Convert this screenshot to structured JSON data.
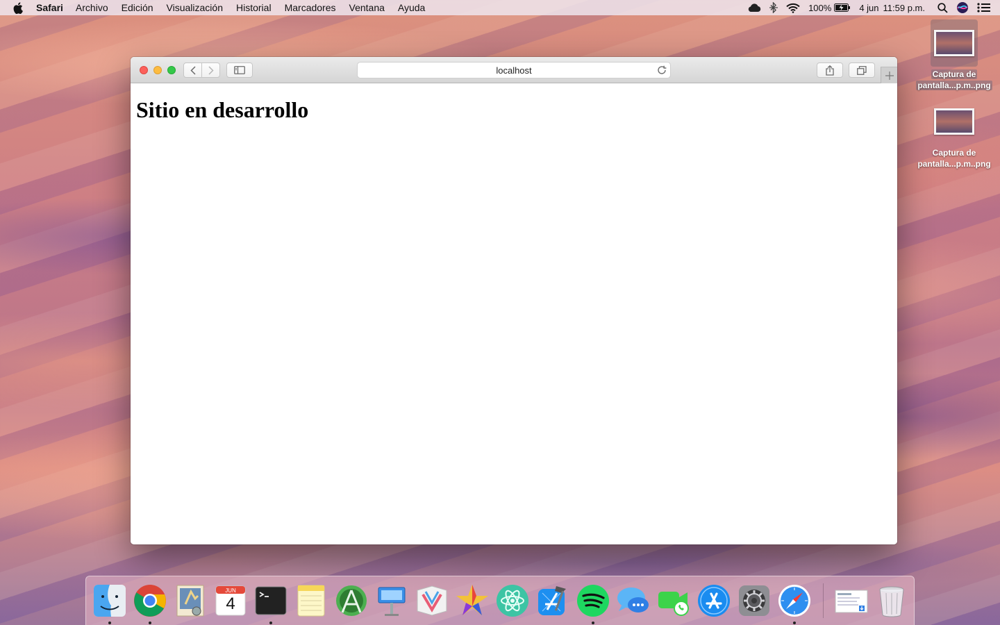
{
  "menubar": {
    "app_name": "Safari",
    "items": [
      "Archivo",
      "Edición",
      "Visualización",
      "Historial",
      "Marcadores",
      "Ventana",
      "Ayuda"
    ],
    "battery": "100%",
    "date": "4 jun",
    "time": "11:59 p.m."
  },
  "desktop": {
    "files": [
      {
        "line1": "Captura de",
        "line2": "pantalla...p.m..png",
        "selected": true
      },
      {
        "line1": "Captura de",
        "line2": "pantalla...p.m..png",
        "selected": false
      }
    ]
  },
  "browser": {
    "url": "localhost",
    "page_heading": "Sitio en desarrollo"
  },
  "dock": {
    "calendar_month": "JUN",
    "calendar_day": "4"
  }
}
